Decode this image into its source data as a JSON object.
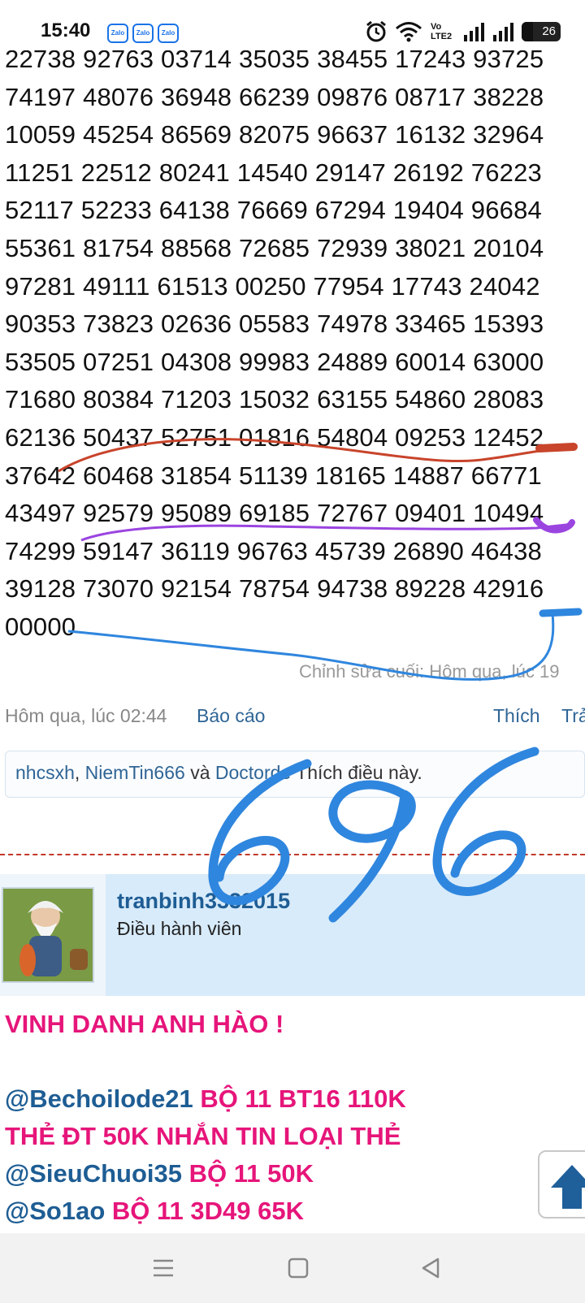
{
  "status": {
    "time": "15:40",
    "apps": [
      "Zalo",
      "Zalo",
      "Zalo"
    ],
    "network": "Vo LTE2",
    "battery": "26"
  },
  "numbers": [
    "22738 92763 03714 35035 38455 17243 93725",
    "74197 48076 36948 66239 09876 08717 38228",
    "10059 45254 86569 82075 96637 16132 32964",
    "11251 22512 80241 14540 29147 26192 76223",
    "52117 52233 64138 76669 67294 19404 96684",
    "55361 81754 88568 72685 72939 38021 20104",
    "97281 49111 61513 00250 77954 17743 24042",
    "90353 73823 02636 05583 74978 33465 15393",
    "53505 07251 04308 99983 24889 60014 63000",
    "71680 80384 71203 15032 63155 54860 28083",
    "62136 50437 52751 01816 54804 09253 12452",
    "37642 60468 31854 51139 18165 14887 66771",
    "43497 92579 95089 69185 72767 09401 10494",
    "74299 59147 36119 96763 45739 26890 46438",
    "39128 73070 92154 78754 94738 89228 42916",
    "00000"
  ],
  "post": {
    "edited": "Chỉnh sửa cuối: Hôm qua, lúc 19",
    "time": "Hôm qua, lúc 02:44",
    "report": "Báo cáo",
    "like": "Thích",
    "reply": "Trả",
    "likes_users": [
      "nhcsxh",
      "NiemTin666",
      "Doctorde"
    ],
    "likes_sep": ", ",
    "likes_and": " và ",
    "likes_suffix": " Thích điều này."
  },
  "handwritten": "696",
  "next_post": {
    "username": "tranbinh3332015",
    "role": "Điều hành viên",
    "lines": [
      [
        {
          "text": "VINH DANH ANH HÀO !",
          "color": "pink"
        }
      ],
      [],
      [
        {
          "text": "@Bechoilode21",
          "color": "blue"
        },
        {
          "text": " BỘ 11 BT16 110K",
          "color": "pink"
        }
      ],
      [
        {
          "text": "THẺ ĐT 50K NHẮN TIN LOẠI THẺ",
          "color": "pink"
        }
      ],
      [
        {
          "text": "@SieuChuoi35",
          "color": "blue"
        },
        {
          "text": " BỘ 11 50K",
          "color": "pink"
        }
      ],
      [
        {
          "text": "@So1ao",
          "color": "blue"
        },
        {
          "text": " BỘ 11 3D49 65K",
          "color": "pink"
        }
      ]
    ]
  }
}
